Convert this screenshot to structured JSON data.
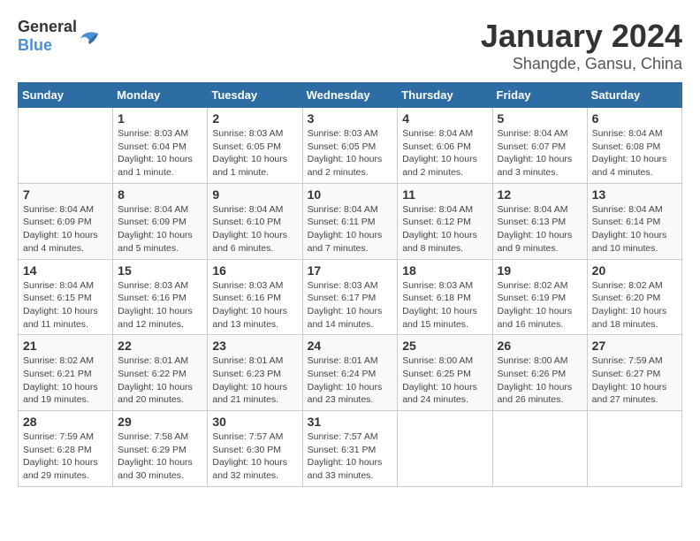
{
  "logo": {
    "text_general": "General",
    "text_blue": "Blue"
  },
  "title": "January 2024",
  "subtitle": "Shangde, Gansu, China",
  "weekdays": [
    "Sunday",
    "Monday",
    "Tuesday",
    "Wednesday",
    "Thursday",
    "Friday",
    "Saturday"
  ],
  "weeks": [
    [
      {
        "day": "",
        "info": ""
      },
      {
        "day": "1",
        "info": "Sunrise: 8:03 AM\nSunset: 6:04 PM\nDaylight: 10 hours\nand 1 minute."
      },
      {
        "day": "2",
        "info": "Sunrise: 8:03 AM\nSunset: 6:05 PM\nDaylight: 10 hours\nand 1 minute."
      },
      {
        "day": "3",
        "info": "Sunrise: 8:03 AM\nSunset: 6:05 PM\nDaylight: 10 hours\nand 2 minutes."
      },
      {
        "day": "4",
        "info": "Sunrise: 8:04 AM\nSunset: 6:06 PM\nDaylight: 10 hours\nand 2 minutes."
      },
      {
        "day": "5",
        "info": "Sunrise: 8:04 AM\nSunset: 6:07 PM\nDaylight: 10 hours\nand 3 minutes."
      },
      {
        "day": "6",
        "info": "Sunrise: 8:04 AM\nSunset: 6:08 PM\nDaylight: 10 hours\nand 4 minutes."
      }
    ],
    [
      {
        "day": "7",
        "info": "Sunrise: 8:04 AM\nSunset: 6:09 PM\nDaylight: 10 hours\nand 4 minutes."
      },
      {
        "day": "8",
        "info": "Sunrise: 8:04 AM\nSunset: 6:09 PM\nDaylight: 10 hours\nand 5 minutes."
      },
      {
        "day": "9",
        "info": "Sunrise: 8:04 AM\nSunset: 6:10 PM\nDaylight: 10 hours\nand 6 minutes."
      },
      {
        "day": "10",
        "info": "Sunrise: 8:04 AM\nSunset: 6:11 PM\nDaylight: 10 hours\nand 7 minutes."
      },
      {
        "day": "11",
        "info": "Sunrise: 8:04 AM\nSunset: 6:12 PM\nDaylight: 10 hours\nand 8 minutes."
      },
      {
        "day": "12",
        "info": "Sunrise: 8:04 AM\nSunset: 6:13 PM\nDaylight: 10 hours\nand 9 minutes."
      },
      {
        "day": "13",
        "info": "Sunrise: 8:04 AM\nSunset: 6:14 PM\nDaylight: 10 hours\nand 10 minutes."
      }
    ],
    [
      {
        "day": "14",
        "info": "Sunrise: 8:04 AM\nSunset: 6:15 PM\nDaylight: 10 hours\nand 11 minutes."
      },
      {
        "day": "15",
        "info": "Sunrise: 8:03 AM\nSunset: 6:16 PM\nDaylight: 10 hours\nand 12 minutes."
      },
      {
        "day": "16",
        "info": "Sunrise: 8:03 AM\nSunset: 6:16 PM\nDaylight: 10 hours\nand 13 minutes."
      },
      {
        "day": "17",
        "info": "Sunrise: 8:03 AM\nSunset: 6:17 PM\nDaylight: 10 hours\nand 14 minutes."
      },
      {
        "day": "18",
        "info": "Sunrise: 8:03 AM\nSunset: 6:18 PM\nDaylight: 10 hours\nand 15 minutes."
      },
      {
        "day": "19",
        "info": "Sunrise: 8:02 AM\nSunset: 6:19 PM\nDaylight: 10 hours\nand 16 minutes."
      },
      {
        "day": "20",
        "info": "Sunrise: 8:02 AM\nSunset: 6:20 PM\nDaylight: 10 hours\nand 18 minutes."
      }
    ],
    [
      {
        "day": "21",
        "info": "Sunrise: 8:02 AM\nSunset: 6:21 PM\nDaylight: 10 hours\nand 19 minutes."
      },
      {
        "day": "22",
        "info": "Sunrise: 8:01 AM\nSunset: 6:22 PM\nDaylight: 10 hours\nand 20 minutes."
      },
      {
        "day": "23",
        "info": "Sunrise: 8:01 AM\nSunset: 6:23 PM\nDaylight: 10 hours\nand 21 minutes."
      },
      {
        "day": "24",
        "info": "Sunrise: 8:01 AM\nSunset: 6:24 PM\nDaylight: 10 hours\nand 23 minutes."
      },
      {
        "day": "25",
        "info": "Sunrise: 8:00 AM\nSunset: 6:25 PM\nDaylight: 10 hours\nand 24 minutes."
      },
      {
        "day": "26",
        "info": "Sunrise: 8:00 AM\nSunset: 6:26 PM\nDaylight: 10 hours\nand 26 minutes."
      },
      {
        "day": "27",
        "info": "Sunrise: 7:59 AM\nSunset: 6:27 PM\nDaylight: 10 hours\nand 27 minutes."
      }
    ],
    [
      {
        "day": "28",
        "info": "Sunrise: 7:59 AM\nSunset: 6:28 PM\nDaylight: 10 hours\nand 29 minutes."
      },
      {
        "day": "29",
        "info": "Sunrise: 7:58 AM\nSunset: 6:29 PM\nDaylight: 10 hours\nand 30 minutes."
      },
      {
        "day": "30",
        "info": "Sunrise: 7:57 AM\nSunset: 6:30 PM\nDaylight: 10 hours\nand 32 minutes."
      },
      {
        "day": "31",
        "info": "Sunrise: 7:57 AM\nSunset: 6:31 PM\nDaylight: 10 hours\nand 33 minutes."
      },
      {
        "day": "",
        "info": ""
      },
      {
        "day": "",
        "info": ""
      },
      {
        "day": "",
        "info": ""
      }
    ]
  ]
}
